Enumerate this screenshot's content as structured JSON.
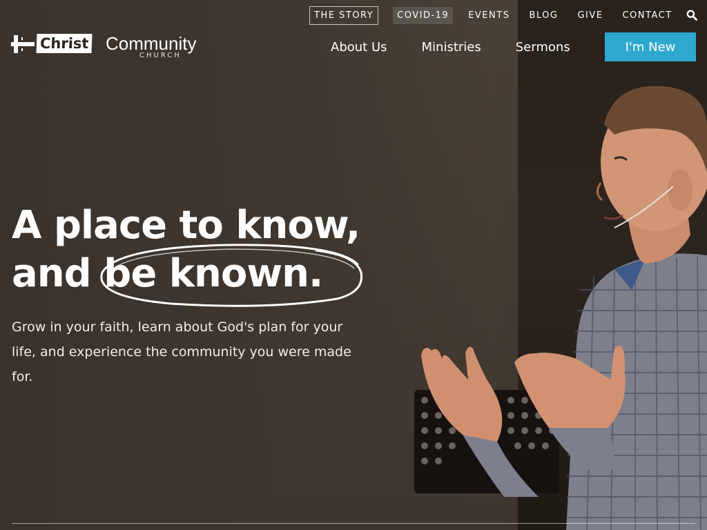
{
  "colors": {
    "accent": "#2fa8cf",
    "background": "#3a332d",
    "covid_highlight": "#5b5550",
    "text": "#ffffff"
  },
  "logo": {
    "icon": "cross-icon",
    "christ": "Christ",
    "community": "Community",
    "church": "CHURCH"
  },
  "utility_nav": {
    "items": [
      "THE STORY",
      "COVID-19",
      "EVENTS",
      "BLOG",
      "GIVE",
      "CONTACT"
    ],
    "search_icon": "search-icon"
  },
  "main_nav": {
    "items": [
      "About Us",
      "Ministries",
      "Sermons"
    ],
    "cta": "I'm New"
  },
  "hero": {
    "headline_line1": "A place to know,",
    "headline_line2": "and be known.",
    "subhead": "Grow in your faith, learn about God's plan for your life, and experience the community you were made for."
  }
}
